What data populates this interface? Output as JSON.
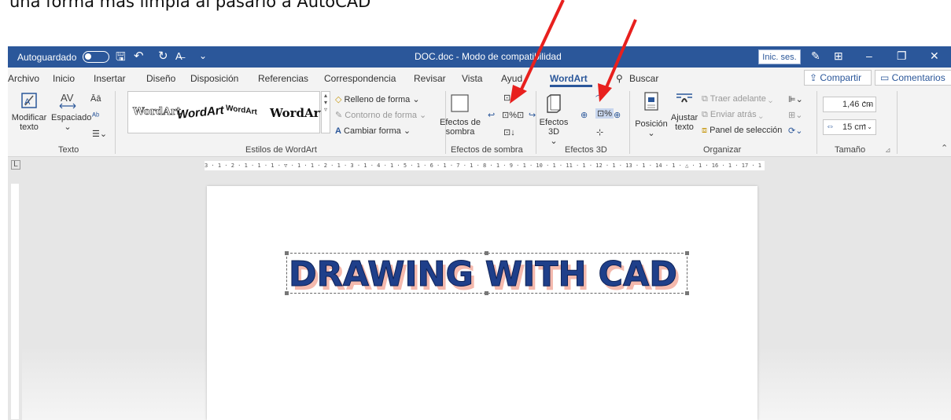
{
  "caption": "una forma más limpia al pasarlo a AutoCAD",
  "titlebar": {
    "autosave_label": "Autoguardado",
    "document_title": "DOC.doc  -  Modo de compatibilidad",
    "signin_label": "Inic. ses."
  },
  "tabs": [
    "Archivo",
    "Inicio",
    "Insertar",
    "Diseño",
    "Disposición",
    "Referencias",
    "Correspondencia",
    "Revisar",
    "Vista",
    "Ayud",
    "WordArt",
    "Buscar"
  ],
  "active_tab": "WordArt",
  "share_label": "Compartir",
  "comments_label": "Comentarios",
  "ribbon": {
    "texto": {
      "modificar_label": "Modificar texto",
      "espaciado_label": "Espaciado",
      "group_label": "Texto"
    },
    "estilos": {
      "gallery_items": [
        "WordArt",
        "WordArt",
        "WordArt",
        "WordArt"
      ],
      "relleno": "Relleno de forma",
      "contorno": "Contorno de forma",
      "cambiar": "Cambiar forma",
      "group_label": "Estilos de WordArt"
    },
    "sombra": {
      "efectos_label": "Efectos de sombra",
      "group_label": "Efectos de sombra"
    },
    "efectos3d": {
      "efectos_label": "Efectos 3D",
      "group_label": "Efectos 3D"
    },
    "organizar": {
      "posicion": "Posición",
      "ajustar": "Ajustar texto",
      "traer": "Traer adelante",
      "enviar": "Enviar atrás",
      "panel": "Panel de selección",
      "group_label": "Organizar"
    },
    "tamano": {
      "height": "1,46 cm",
      "width": "15 cm",
      "group_label": "Tamaño"
    }
  },
  "ruler_text": "3 · 1 · 2 · 1 · 1 · 1 · ▽ · 1 · 1 · 2 · 1 · 3 · 1 · 4 · 1 · 5 · 1 · 6 · 1 · 7 · 1 · 8 · 1 · 9 · 1 · 10 · 1 · 11 · 1 · 12 · 1 · 13 · 1 · 14 · 1 · △ · 1 · 16 · 1 · 17 · 1 ·",
  "wordart_text": "DRAWING WITH CAD",
  "colors": {
    "accent": "#2b579a",
    "wordart_fill": "#1f3f8a",
    "wordart_shadow": "#f4b9ad",
    "arrow": "#e8201e"
  }
}
